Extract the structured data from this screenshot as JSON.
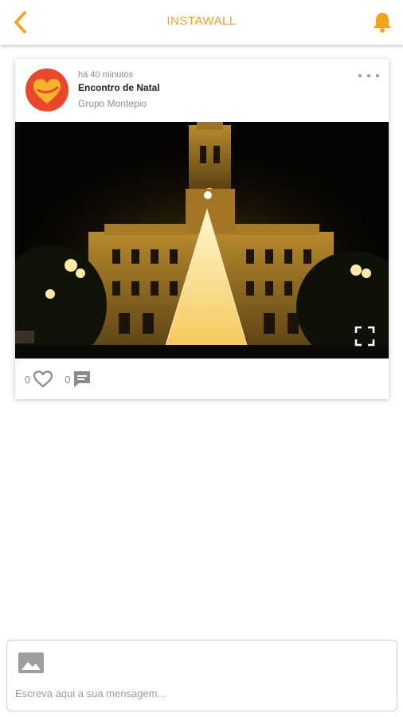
{
  "header": {
    "title": "INSTAWALL",
    "back_icon": "chevron-left-icon",
    "bell_icon": "bell-icon"
  },
  "post": {
    "time": "há 40 minutos",
    "title": "Encontro de Natal",
    "group": "Grupo Montepio",
    "likes": "0",
    "comments": "0",
    "more_icon": "more-horizontal-icon",
    "expand_icon": "fullscreen-icon",
    "like_icon": "heart-outline-icon",
    "comment_icon": "comment-icon"
  },
  "composer": {
    "placeholder": "Escreva aqui a sua mensagem...",
    "image_icon": "image-icon"
  },
  "colors": {
    "accent": "#f2a31b",
    "avatar_bg": "#e9482a",
    "avatar_heart": "#f7b32b"
  }
}
